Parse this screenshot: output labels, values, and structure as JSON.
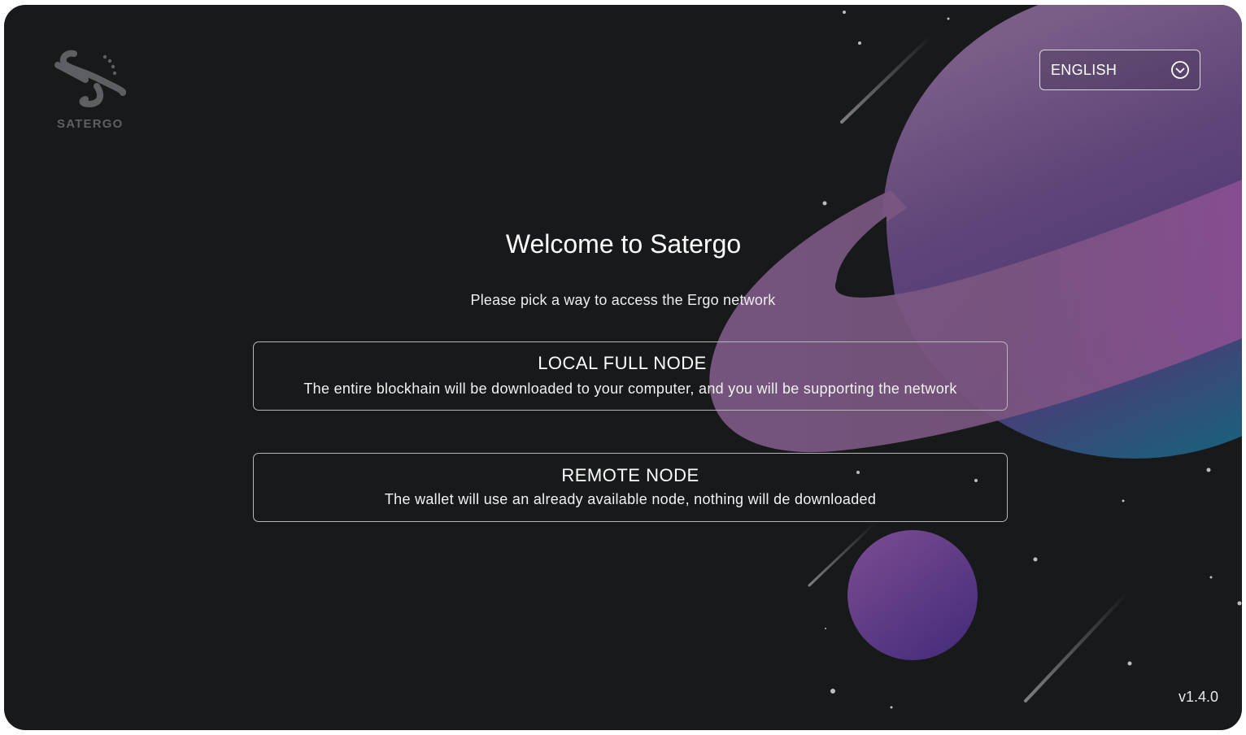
{
  "app": {
    "name": "SATERGO",
    "version": "v1.4.0"
  },
  "language_select": {
    "selected": "ENGLISH",
    "icon": "chevron-down-circle-icon"
  },
  "welcome": {
    "title": "Welcome to Satergo",
    "subtitle": "Please pick a way to access the Ergo network"
  },
  "options": [
    {
      "title": "LOCAL FULL NODE",
      "description": "The entire blockhain will be downloaded to your computer, and you will be supporting the network"
    },
    {
      "title": "REMOTE NODE",
      "description": "The wallet will use an already available node, nothing will de downloaded"
    }
  ],
  "colors": {
    "background": "#18191b",
    "planet_purple": "#6b4d84",
    "planet_teal": "#1d6b82",
    "moon_purple": "#5a3586",
    "border": "#b7b6ba",
    "text": "#ffffff"
  }
}
